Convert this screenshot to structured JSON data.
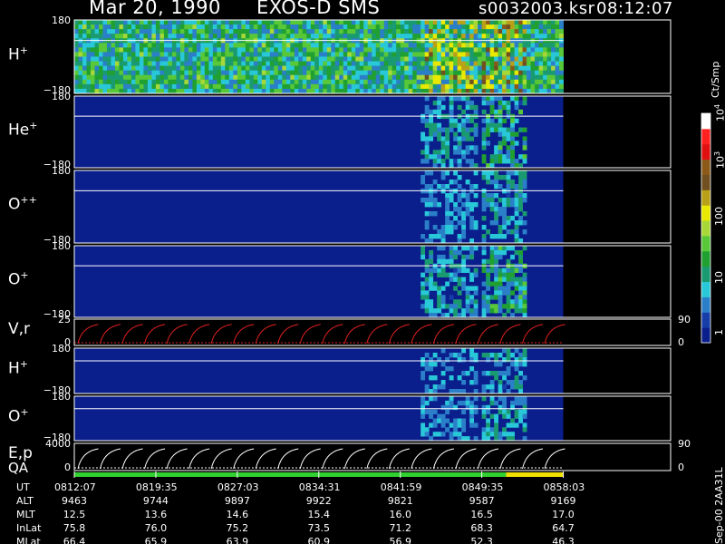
{
  "header": {
    "date": "Mar 20, 1990",
    "instrument": "EXOS-D SMS",
    "file": "s0032003.ksr",
    "time": "08:12:07"
  },
  "colorbar": {
    "unit": "Ct/Smp",
    "ticks": [
      "1",
      "10",
      "100",
      "10",
      "10"
    ],
    "exponents": [
      "3",
      "4"
    ],
    "colors": [
      "#0a1e8c",
      "#173ea8",
      "#2a7fc8",
      "#28c8d8",
      "#1a9a70",
      "#20a030",
      "#58c838",
      "#a8d838",
      "#e8e800",
      "#b8a018",
      "#705020",
      "#8c5a18",
      "#e01010",
      "#ff2020",
      "#ffffff"
    ]
  },
  "chart_data": {
    "type": "heatmap",
    "panels": [
      {
        "label": "H",
        "sup": "+",
        "ymax": "180",
        "ymin": "−180",
        "intensity": "high"
      },
      {
        "label": "He",
        "sup": "+",
        "ymax": "180",
        "ymin": "−180",
        "intensity": "medium"
      },
      {
        "label": "O",
        "sup": "++",
        "ymax": "180",
        "ymin": "−180",
        "intensity": "low"
      },
      {
        "label": "O",
        "sup": "+",
        "ymax": "180",
        "ymin": "−180",
        "intensity": "medium"
      },
      {
        "label": "V,r",
        "sup": "",
        "ymax": "25",
        "ymin": "0",
        "right_max": "90",
        "right_min": "0",
        "kind": "line",
        "color": "#e02020"
      },
      {
        "label": "H",
        "sup": "+",
        "ymax": "180",
        "ymin": "−180",
        "intensity": "low"
      },
      {
        "label": "O",
        "sup": "+",
        "ymax": "180",
        "ymin": "−180",
        "intensity": "low"
      },
      {
        "label": "E,p",
        "sup": "",
        "ymax": "4000",
        "ymin": "0",
        "right_max": "90",
        "right_min": "0",
        "kind": "line",
        "color": "#ffffff"
      }
    ],
    "qa_label": "QA",
    "qa_segments": [
      {
        "from": 0.0,
        "to": 0.883,
        "color": "#30d030"
      },
      {
        "from": 0.883,
        "to": 1.0,
        "color": "#f0e000"
      }
    ],
    "data_end_fraction": 0.82,
    "x_axis": {
      "rows": [
        {
          "label": "UT",
          "values": [
            "0812:07",
            "0819:35",
            "0827:03",
            "0834:31",
            "0841:59",
            "0849:35",
            "0858:03"
          ]
        },
        {
          "label": "ALT",
          "values": [
            "9463",
            "9744",
            "9897",
            "9922",
            "9821",
            "9587",
            "9169"
          ]
        },
        {
          "label": "MLT",
          "values": [
            "12.5",
            "13.6",
            "14.6",
            "15.4",
            "16.0",
            "16.5",
            "17.0"
          ]
        },
        {
          "label": "InLat",
          "values": [
            "75.8",
            "76.0",
            "75.2",
            "73.5",
            "71.2",
            "68.3",
            "64.7"
          ]
        },
        {
          "label": "MLat",
          "values": [
            "66.4",
            "65.9",
            "63.9",
            "60.9",
            "56.9",
            "52.3",
            "46.3"
          ]
        }
      ]
    },
    "footer_note": "Sep-00 2AA31L"
  }
}
